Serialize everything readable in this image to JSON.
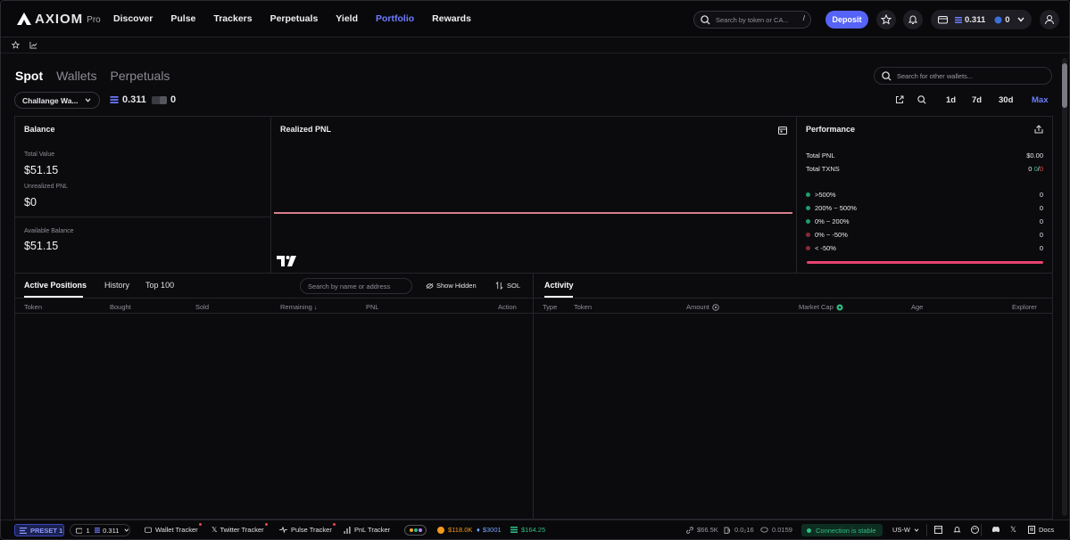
{
  "brand": {
    "name": "AXIOM",
    "suffix": "Pro"
  },
  "nav": [
    "Discover",
    "Pulse",
    "Trackers",
    "Perpetuals",
    "Yield",
    "Portfolio",
    "Rewards"
  ],
  "nav_active": "Portfolio",
  "top_search": {
    "placeholder": "Search by token or CA...",
    "shortcut": "/"
  },
  "deposit_label": "Deposit",
  "wallet_pill": {
    "sol": "0.311",
    "other": "0"
  },
  "tabs": [
    "Spot",
    "Wallets",
    "Perpetuals"
  ],
  "tabs_active": "Spot",
  "wallet_search_placeholder": "Search for other wallets...",
  "wallet_select": "Challange Wa...",
  "sol_balance": "0.311",
  "usd_balance": "0",
  "timeframes": [
    "1d",
    "7d",
    "30d",
    "Max"
  ],
  "timeframe_active": "Max",
  "balance": {
    "title": "Balance",
    "total_value_label": "Total Value",
    "total_value": "$51.15",
    "unrealized_label": "Unrealized PNL",
    "unrealized": "$0",
    "available_label": "Available Balance",
    "available": "$51.15"
  },
  "realized_pnl": {
    "title": "Realized PNL"
  },
  "performance": {
    "title": "Performance",
    "total_pnl_label": "Total PNL",
    "total_pnl": "$0.00",
    "total_txns_label": "Total TXNS",
    "total_txns": "0",
    "txns_buy": "0",
    "txns_sep": "/",
    "txns_sell": "0",
    "buckets": [
      {
        "label": ">500%",
        "value": "0",
        "color": "#1f9d6b"
      },
      {
        "label": "200% ~ 500%",
        "value": "0",
        "color": "#1f9d6b"
      },
      {
        "label": "0% ~ 200%",
        "value": "0",
        "color": "#1f9d6b"
      },
      {
        "label": "0% ~ -50%",
        "value": "0",
        "color": "#8a2a3a"
      },
      {
        "label": "< -50%",
        "value": "0",
        "color": "#8a2a3a"
      }
    ],
    "bar_color": "#e8436f"
  },
  "positions": {
    "tabs": [
      "Active Positions",
      "History",
      "Top 100"
    ],
    "active_tab": "Active Positions",
    "search_placeholder": "Search by name or address",
    "show_hidden": "Show Hidden",
    "currency": "SOL",
    "columns": [
      "Token",
      "Bought",
      "Sold",
      "Remaining",
      "PNL",
      "Action"
    ]
  },
  "activity": {
    "title": "Activity",
    "columns": [
      "Type",
      "Token",
      "Amount",
      "Market Cap",
      "Age",
      "Explorer"
    ]
  },
  "footer": {
    "preset": "PRESET 1",
    "wallet_count": "1",
    "wallet_sol": "0.311",
    "trackers": [
      "Wallet Tracker",
      "Twitter Tracker",
      "Pulse Tracker",
      "PnL Tracker"
    ],
    "btc": "$118.0K",
    "eth": "$3001",
    "sol": "$164.25",
    "stat1": "$66.5K",
    "stat2": "0.0₂16",
    "stat3": "0.0159",
    "connection": "Connection is stable",
    "region": "US-W",
    "docs": "Docs"
  }
}
